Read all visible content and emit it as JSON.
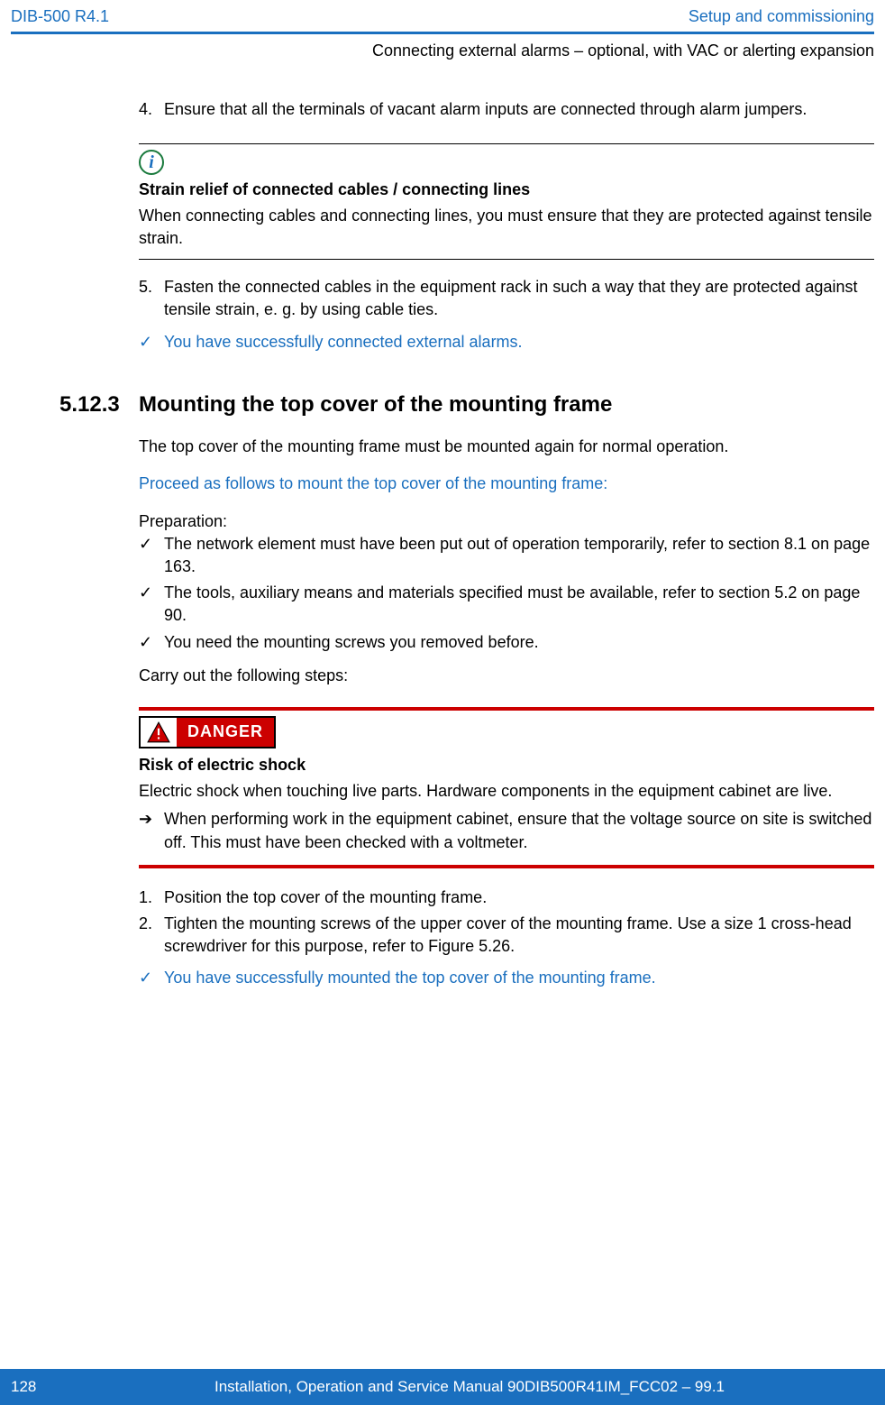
{
  "header": {
    "doc_id": "DIB-500 R4.1",
    "chapter": "Setup and commissioning"
  },
  "subheader": "Connecting external alarms – optional, with VAC or alerting expansion",
  "step4": {
    "num": "4.",
    "text": "Ensure that all the terminals of vacant alarm inputs are connected through alarm jumpers."
  },
  "note1": {
    "title": "Strain relief of connected cables / connecting lines",
    "body": "When connecting cables and connecting lines, you must ensure that they are protected against tensile strain."
  },
  "step5": {
    "num": "5.",
    "text": "Fasten the connected cables in the equipment rack in such a way that they are protected against tensile strain, e. g. by using cable ties."
  },
  "success1": "You have successfully connected external alarms.",
  "section": {
    "num": "5.12.3",
    "title": "Mounting the top cover of the mounting frame"
  },
  "intro": "The top cover of the mounting frame must be mounted again for normal operation.",
  "proceed": "Proceed as follows to mount the top cover of the mounting frame:",
  "prep_label": "Preparation:",
  "prep1": "The network element must have been put out of operation temporarily, refer to section 8.1 on page 163.",
  "prep2": "The tools, auxiliary means and materials specified must be available, refer to section 5.2 on page 90.",
  "prep3": "You need the mounting screws you removed before.",
  "carry": "Carry out the following steps:",
  "danger": {
    "label": "DANGER",
    "title": "Risk of electric shock",
    "body": "Electric shock when touching live parts. Hardware components in the equipment cabinet are live.",
    "action": "When performing work in the equipment cabinet, ensure that the voltage source on site is switched off. This must have been checked with a voltmeter."
  },
  "step_a": {
    "num": "1.",
    "text": "Position the top cover of the mounting frame."
  },
  "step_b": {
    "num": "2.",
    "text": "Tighten the mounting screws of the upper cover of the mounting frame. Use a size 1 cross-head screwdriver for this purpose, refer to Figure 5.26."
  },
  "success2": "You have successfully mounted the top cover of the mounting frame.",
  "footer": {
    "page": "128",
    "title": "Installation, Operation and Service Manual 90DIB500R41IM_FCC02 – 99.1"
  }
}
